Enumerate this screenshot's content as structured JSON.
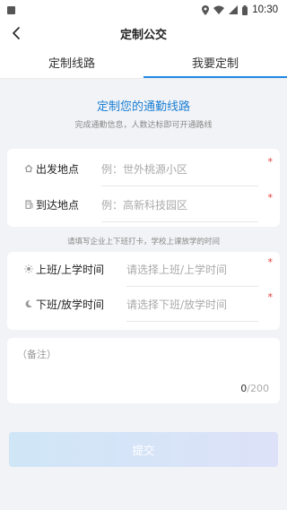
{
  "status": {
    "time": "10:30"
  },
  "header": {
    "title": "定制公交"
  },
  "tabs": [
    {
      "label": "定制线路",
      "active": false
    },
    {
      "label": "我要定制",
      "active": true
    }
  ],
  "intro": {
    "title": "定制您的通勤线路",
    "subtitle": "完成通勤信息，人数达标即可开通路线"
  },
  "locations": {
    "departure": {
      "label": "出发地点",
      "placeholder": "例：世外桃源小区",
      "icon": "home-icon"
    },
    "arrival": {
      "label": "到达地点",
      "placeholder": "例：高新科技园区",
      "icon": "building-icon"
    }
  },
  "hint": "请填写企业上下班打卡，学校上课放学的时间",
  "times": {
    "start": {
      "label": "上班/上学时间",
      "placeholder": "请选择上班/上学时间",
      "icon": "sun-icon"
    },
    "end": {
      "label": "下班/放学时间",
      "placeholder": "请选择下班/放学时间",
      "icon": "moon-icon"
    }
  },
  "required_mark": "*",
  "remark": {
    "label": "（备注）",
    "count": "0",
    "max": "/200"
  },
  "submit": {
    "label": "提交"
  },
  "colors": {
    "accent": "#1e88e5",
    "required": "#e53935"
  }
}
